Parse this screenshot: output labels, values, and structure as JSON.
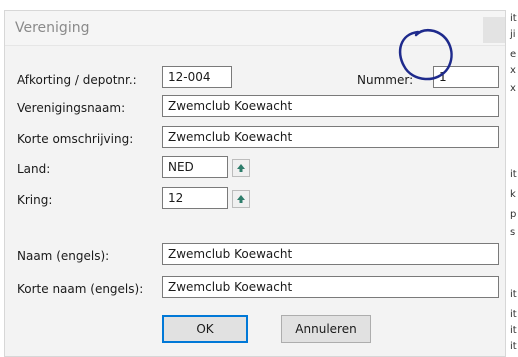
{
  "dialog": {
    "title": "Vereniging"
  },
  "fields": {
    "afkorting": {
      "label": "Afkorting / depotnr.:",
      "value": "12-004"
    },
    "nummer": {
      "label": "Nummer:",
      "value": "1"
    },
    "verenigingsnaam": {
      "label": "Verenigingsnaam:",
      "value": "Zwemclub Koewacht"
    },
    "korte_omschrijving": {
      "label": "Korte omschrijving:",
      "value": "Zwemclub Koewacht"
    },
    "land": {
      "label": "Land:",
      "value": "NED"
    },
    "kring": {
      "label": "Kring:",
      "value": "12"
    },
    "naam_engels": {
      "label": "Naam (engels):",
      "value": "Zwemclub Koewacht"
    },
    "korte_naam_engels": {
      "label": "Korte naam (engels):",
      "value": "Zwemclub Koewacht"
    }
  },
  "buttons": {
    "ok": "OK",
    "cancel": "Annuleren"
  },
  "background_edge_text": [
    "it",
    "ji",
    "e",
    "x",
    "x",
    "it",
    "k",
    "p",
    "s",
    "it",
    "it",
    "it",
    "it"
  ],
  "colors": {
    "annotation": "#1e2a8c",
    "spin_arrow": "#2e7d6b",
    "ok_border": "#0078d7"
  },
  "icons": {
    "spin": "up-arrow-icon"
  }
}
